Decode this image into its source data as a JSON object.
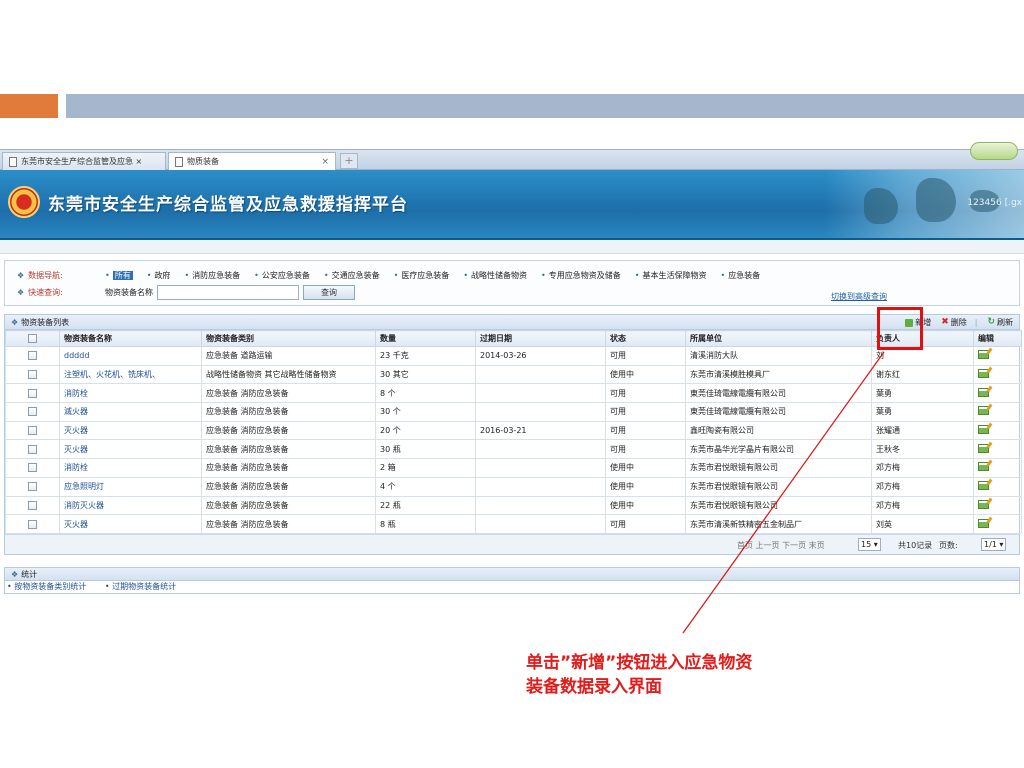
{
  "browser": {
    "tabs": [
      {
        "label": "东莞市安全生产综合监管及应急 ×"
      },
      {
        "label": "物质装备"
      }
    ],
    "new_tab": "+"
  },
  "header": {
    "title": "东莞市安全生产综合监管及应急救援指挥平台",
    "user": "123456 [.gx"
  },
  "nav": {
    "data_nav_label": "数据导航:",
    "quick_search_label": "快速查询:",
    "categories": [
      "所有",
      "政府",
      "消防应急装备",
      "公安应急装备",
      "交通应急装备",
      "医疗应急装备",
      "战略性储备物资",
      "专用应急物资及储备",
      "基本生活保障物资",
      "应急装备"
    ],
    "search_field_label": "物资装备名称",
    "search_value": "",
    "search_button": "查询",
    "advanced_link": "切换到高级查询"
  },
  "list": {
    "title": "物资装备列表",
    "toolbar": {
      "add": "新增",
      "delete": "删除",
      "separator": "|",
      "refresh": "刷新"
    },
    "columns": [
      "物资装备名称",
      "物资装备类别",
      "数量",
      "过期日期",
      "状态",
      "所属单位",
      "负责人",
      "编辑"
    ],
    "rows": [
      {
        "name": "ddddd",
        "category": "应急装备 道路运输",
        "qty": "23 千克",
        "expiry": "2014-03-26",
        "status": "可用",
        "unit": "清溪消防大队",
        "owner": "刘"
      },
      {
        "name": "注塑机、火花机、铣床机、",
        "category": "战略性储备物资 其它战略性储备物资",
        "qty": "30 其它",
        "expiry": "",
        "status": "使用中",
        "unit": "东莞市清溪模胜模具厂",
        "owner": "谢东红"
      },
      {
        "name": "消防栓",
        "category": "应急装备 消防应急装备",
        "qty": "8 个",
        "expiry": "",
        "status": "可用",
        "unit": "東莞佳琦電線電纜有限公司",
        "owner": "葉勇"
      },
      {
        "name": "滅火器",
        "category": "应急装备 消防应急装备",
        "qty": "30 个",
        "expiry": "",
        "status": "可用",
        "unit": "東莞佳琦電線電纜有限公司",
        "owner": "葉勇"
      },
      {
        "name": "灭火器",
        "category": "应急装备 消防应急装备",
        "qty": "20 个",
        "expiry": "2016-03-21",
        "status": "可用",
        "unit": "鑫旺陶瓷有限公司",
        "owner": "张耀通"
      },
      {
        "name": "灭火器",
        "category": "应急装备 消防应急装备",
        "qty": "30 瓶",
        "expiry": "",
        "status": "可用",
        "unit": "东莞市晶华光学晶片有限公司",
        "owner": "王秋冬"
      },
      {
        "name": "消防栓",
        "category": "应急装备 消防应急装备",
        "qty": "2 箱",
        "expiry": "",
        "status": "使用中",
        "unit": "东莞市君悦眼镜有限公司",
        "owner": "邓方梅"
      },
      {
        "name": "应急照明灯",
        "category": "应急装备 消防应急装备",
        "qty": "4 个",
        "expiry": "",
        "status": "使用中",
        "unit": "东莞市君悦眼镜有限公司",
        "owner": "邓方梅"
      },
      {
        "name": "消防灭火器",
        "category": "应急装备 消防应急装备",
        "qty": "22 瓶",
        "expiry": "",
        "status": "使用中",
        "unit": "东莞市君悦眼镜有限公司",
        "owner": "邓方梅"
      },
      {
        "name": "灭火器",
        "category": "应急装备 消防应急装备",
        "qty": "8 瓶",
        "expiry": "",
        "status": "可用",
        "unit": "东莞市清溪新铁精密五金制品厂",
        "owner": "刘英"
      }
    ],
    "pager": {
      "links": "首页 上一页 下一页 末页",
      "page_size": "15 ▾",
      "total": "共10记录",
      "page_label": "页数:",
      "page_value": "1/1 ▾"
    }
  },
  "stats": {
    "title": "统计",
    "links": [
      "按物资装备类别统计",
      "过期物资装备统计"
    ]
  },
  "annotation": {
    "text": "单击”新增”按钮进入应急物资装备数据录入界面",
    "color": "#e41b1b"
  },
  "colors": {
    "accent_orange": "#e07b3c",
    "bar_blue": "#a5b7cc",
    "header_blue": "#1d6ea8",
    "highlight_red": "#e01010"
  }
}
